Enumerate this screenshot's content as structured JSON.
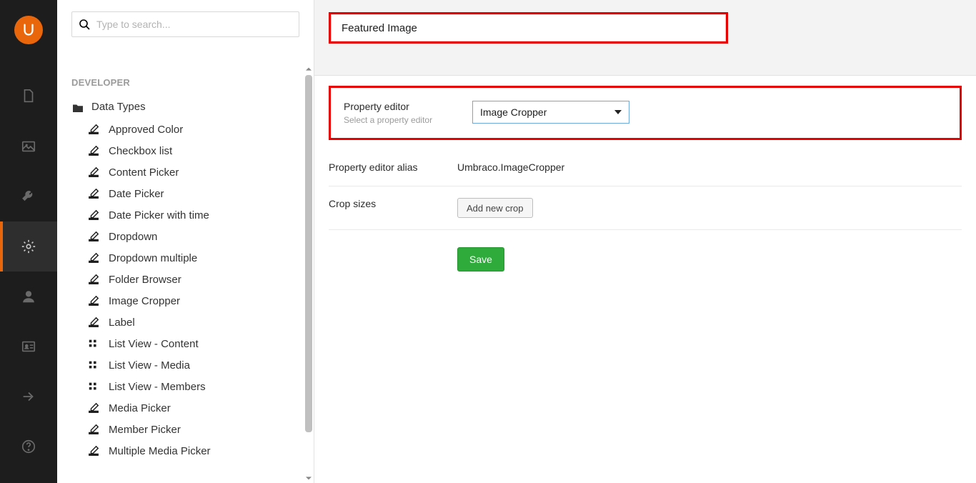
{
  "rail": {
    "logo_letter": "U",
    "items": [
      {
        "name": "content",
        "icon": "document"
      },
      {
        "name": "media",
        "icon": "picture"
      },
      {
        "name": "settings",
        "icon": "wrench"
      },
      {
        "name": "developer",
        "icon": "gear",
        "active": true
      },
      {
        "name": "users",
        "icon": "user"
      },
      {
        "name": "members",
        "icon": "id-card"
      },
      {
        "name": "forms",
        "icon": "arrow-right"
      },
      {
        "name": "help",
        "icon": "help"
      }
    ]
  },
  "sidebar": {
    "search_placeholder": "Type to search...",
    "section_label": "DEVELOPER",
    "root_label": "Data Types",
    "items": [
      {
        "icon": "edit",
        "label": "Approved Color"
      },
      {
        "icon": "edit",
        "label": "Checkbox list"
      },
      {
        "icon": "edit",
        "label": "Content Picker"
      },
      {
        "icon": "edit",
        "label": "Date Picker"
      },
      {
        "icon": "edit",
        "label": "Date Picker with time"
      },
      {
        "icon": "edit",
        "label": "Dropdown"
      },
      {
        "icon": "edit",
        "label": "Dropdown multiple"
      },
      {
        "icon": "edit",
        "label": "Folder Browser"
      },
      {
        "icon": "edit",
        "label": "Image Cropper"
      },
      {
        "icon": "edit",
        "label": "Label"
      },
      {
        "icon": "listview",
        "label": "List View - Content"
      },
      {
        "icon": "listview",
        "label": "List View - Media"
      },
      {
        "icon": "listview",
        "label": "List View - Members"
      },
      {
        "icon": "edit",
        "label": "Media Picker"
      },
      {
        "icon": "edit",
        "label": "Member Picker"
      },
      {
        "icon": "edit",
        "label": "Multiple Media Picker"
      }
    ]
  },
  "editor": {
    "name_value": "Featured Image",
    "property_editor_label": "Property editor",
    "property_editor_help": "Select a property editor",
    "property_editor_selected": "Image Cropper",
    "alias_label": "Property editor alias",
    "alias_value": "Umbraco.ImageCropper",
    "crop_label": "Crop sizes",
    "add_crop_button": "Add new crop",
    "save_button": "Save"
  }
}
